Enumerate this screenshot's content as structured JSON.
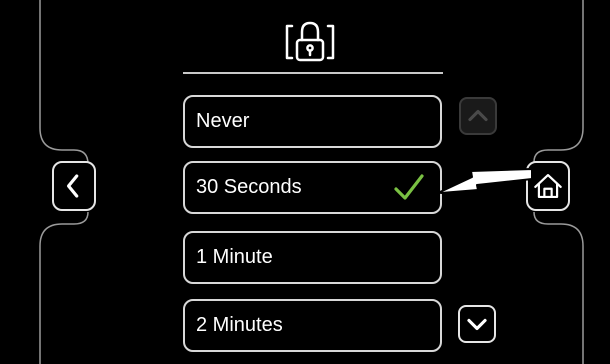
{
  "header": {
    "icon": "lock-icon"
  },
  "options": [
    {
      "label": "Never",
      "selected": false
    },
    {
      "label": "30 Seconds",
      "selected": true
    },
    {
      "label": "1 Minute",
      "selected": false
    },
    {
      "label": "2 Minutes",
      "selected": false
    }
  ],
  "controls": {
    "back_icon": "chevron-left-icon",
    "home_icon": "home-icon",
    "scroll_up_icon": "chevron-up-icon",
    "scroll_down_icon": "chevron-down-icon",
    "selected_icon": "checkmark-icon",
    "callout_icon": "arrow-icon",
    "scroll_up_enabled": false,
    "scroll_down_enabled": true
  },
  "colors": {
    "background": "#000000",
    "text": "#ffffff",
    "border": "#d8d8d8",
    "check": "#7ac143",
    "disabled": "#3a3a3a"
  }
}
